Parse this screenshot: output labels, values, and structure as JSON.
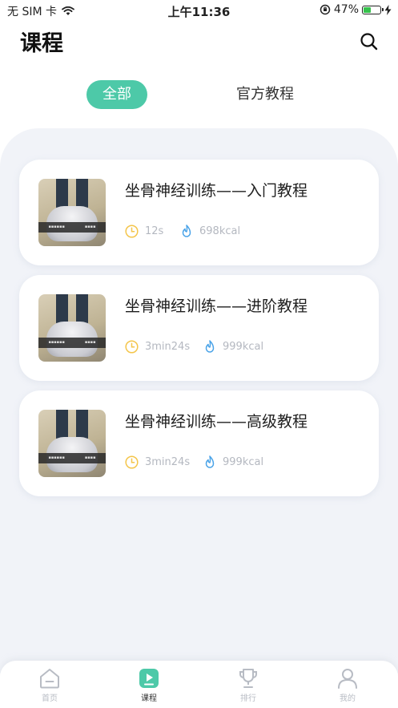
{
  "status_bar": {
    "carrier": "无 SIM 卡",
    "time": "上午11:36",
    "battery": "47%",
    "battery_level": 0.47
  },
  "header": {
    "title": "课程",
    "search_icon": "search-icon"
  },
  "tabs": [
    {
      "label": "全部",
      "active": true
    },
    {
      "label": "官方教程",
      "active": false
    }
  ],
  "courses": [
    {
      "title": "坐骨神经训练——入门教程",
      "duration": "12s",
      "calories": "698kcal"
    },
    {
      "title": "坐骨神经训练——进阶教程",
      "duration": "3min24s",
      "calories": "999kcal"
    },
    {
      "title": "坐骨神经训练——高级教程",
      "duration": "3min24s",
      "calories": "999kcal"
    }
  ],
  "bottom_nav": [
    {
      "label": "首页",
      "icon": "home-icon",
      "active": false
    },
    {
      "label": "课程",
      "icon": "course-play-icon",
      "active": true
    },
    {
      "label": "排行",
      "icon": "trophy-icon",
      "active": false
    },
    {
      "label": "我的",
      "icon": "profile-icon",
      "active": false
    }
  ],
  "colors": {
    "accent": "#4dc9a8",
    "duration_icon": "#f4c54a",
    "calorie_icon": "#4aa3e8",
    "content_bg": "#f1f3f8"
  }
}
